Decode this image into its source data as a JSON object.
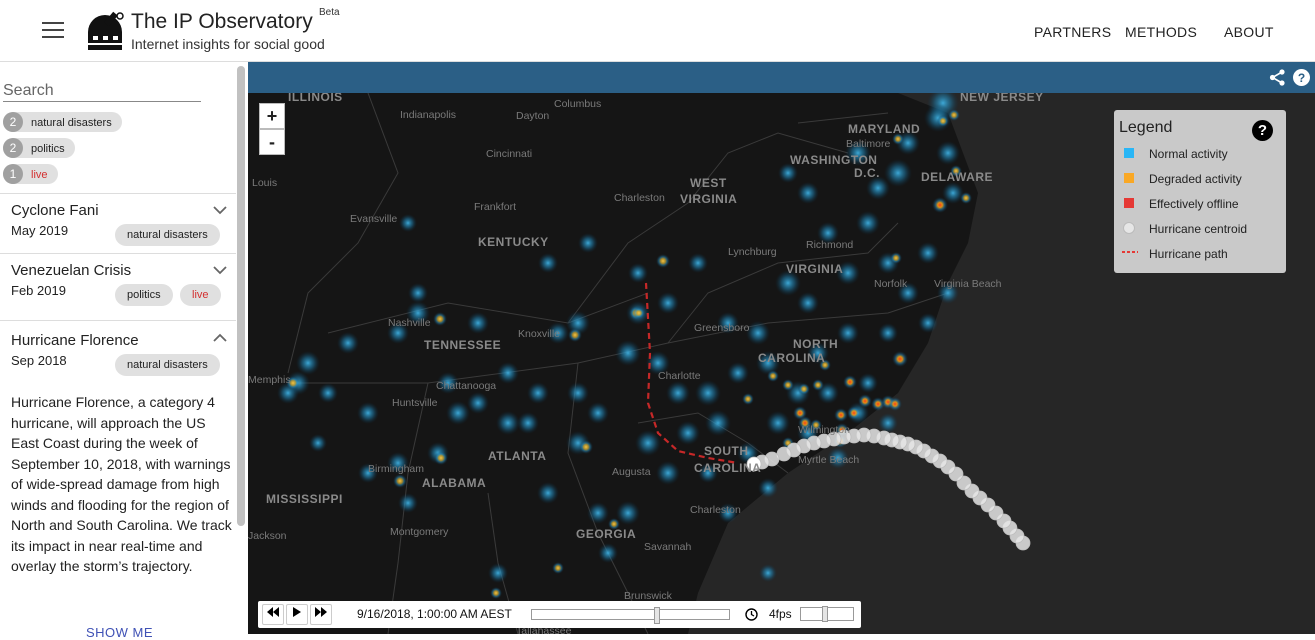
{
  "header": {
    "title": "The IP Observatory",
    "beta": "Beta",
    "subtitle": "Internet insights for social good",
    "nav": [
      "PARTNERS",
      "METHODS",
      "ABOUT"
    ]
  },
  "sidebar": {
    "search_placeholder": "Search",
    "filters": [
      {
        "count": "2",
        "label": "natural disasters"
      },
      {
        "count": "2",
        "label": "politics"
      },
      {
        "count": "1",
        "label": "live"
      }
    ],
    "events": [
      {
        "title": "Cyclone Fani",
        "date": "May 2019",
        "tags": [
          "natural disasters"
        ],
        "expanded": false
      },
      {
        "title": "Venezuelan Crisis",
        "date": "Feb 2019",
        "tags": [
          "politics",
          "live"
        ],
        "expanded": false
      },
      {
        "title": "Hurricane Florence",
        "date": "Sep 2018",
        "tags": [
          "natural disasters"
        ],
        "expanded": true,
        "description": "Hurricane Florence, a category 4 hurricane, will approach the US East Coast during the week of September 10, 2018, with warnings of wide-spread damage from high winds and flooding for the region of North and South Carolina. We track its impact in near real-time and overlay the storm’s trajectory."
      }
    ],
    "show_more": "SHOW ME"
  },
  "map": {
    "zoom_in": "+",
    "zoom_out": "-",
    "states": [
      "ILLINOIS",
      "NEW JERSEY",
      "MARYLAND",
      "WASHINGTON",
      "D.C.",
      "DELAWARE",
      "WEST",
      "VIRGINIA",
      "KENTUCKY",
      "VIRGINIA",
      "TENNESSEE",
      "NORTH",
      "CAROLINA",
      "SOUTH",
      "CAROLINA",
      "ATLANTA",
      "ALABAMA",
      "MISSISSIPPI",
      "GEORGIA"
    ],
    "cities": [
      "Columbus",
      "Indianapolis",
      "Dayton",
      "Cincinnati",
      "Baltimore",
      "Louis",
      "Charleston",
      "Frankfort",
      "Evansville",
      "Richmond",
      "Lynchburg",
      "Norfolk",
      "Virginia Beach",
      "Nashville",
      "Knoxville",
      "Greensboro",
      "Charlotte",
      "Chattanooga",
      "Huntsville",
      "Wilmington",
      "Myrtle Beach",
      "Augusta",
      "Birmingham",
      "Memphis",
      "Charleston",
      "Montgomery",
      "Savannah",
      "Jackson",
      "Brunswick",
      "Tallahassee"
    ],
    "legend": {
      "title": "Legend",
      "help": "?",
      "items": [
        {
          "label": "Normal activity",
          "color": "#29b6f6",
          "kind": "square"
        },
        {
          "label": "Degraded activity",
          "color": "#f9a825",
          "kind": "square"
        },
        {
          "label": "Effectively offline",
          "color": "#e53935",
          "kind": "square"
        },
        {
          "label": "Hurricane centroid",
          "color": "#e6e6e6",
          "kind": "circle"
        },
        {
          "label": "Hurricane path",
          "color": "#e53935",
          "kind": "dashed"
        }
      ]
    },
    "player": {
      "timestamp": "9/16/2018, 1:00:00 AM AEST",
      "progress": 0.64,
      "fps": "4fps",
      "fps_level": 0.45
    }
  }
}
